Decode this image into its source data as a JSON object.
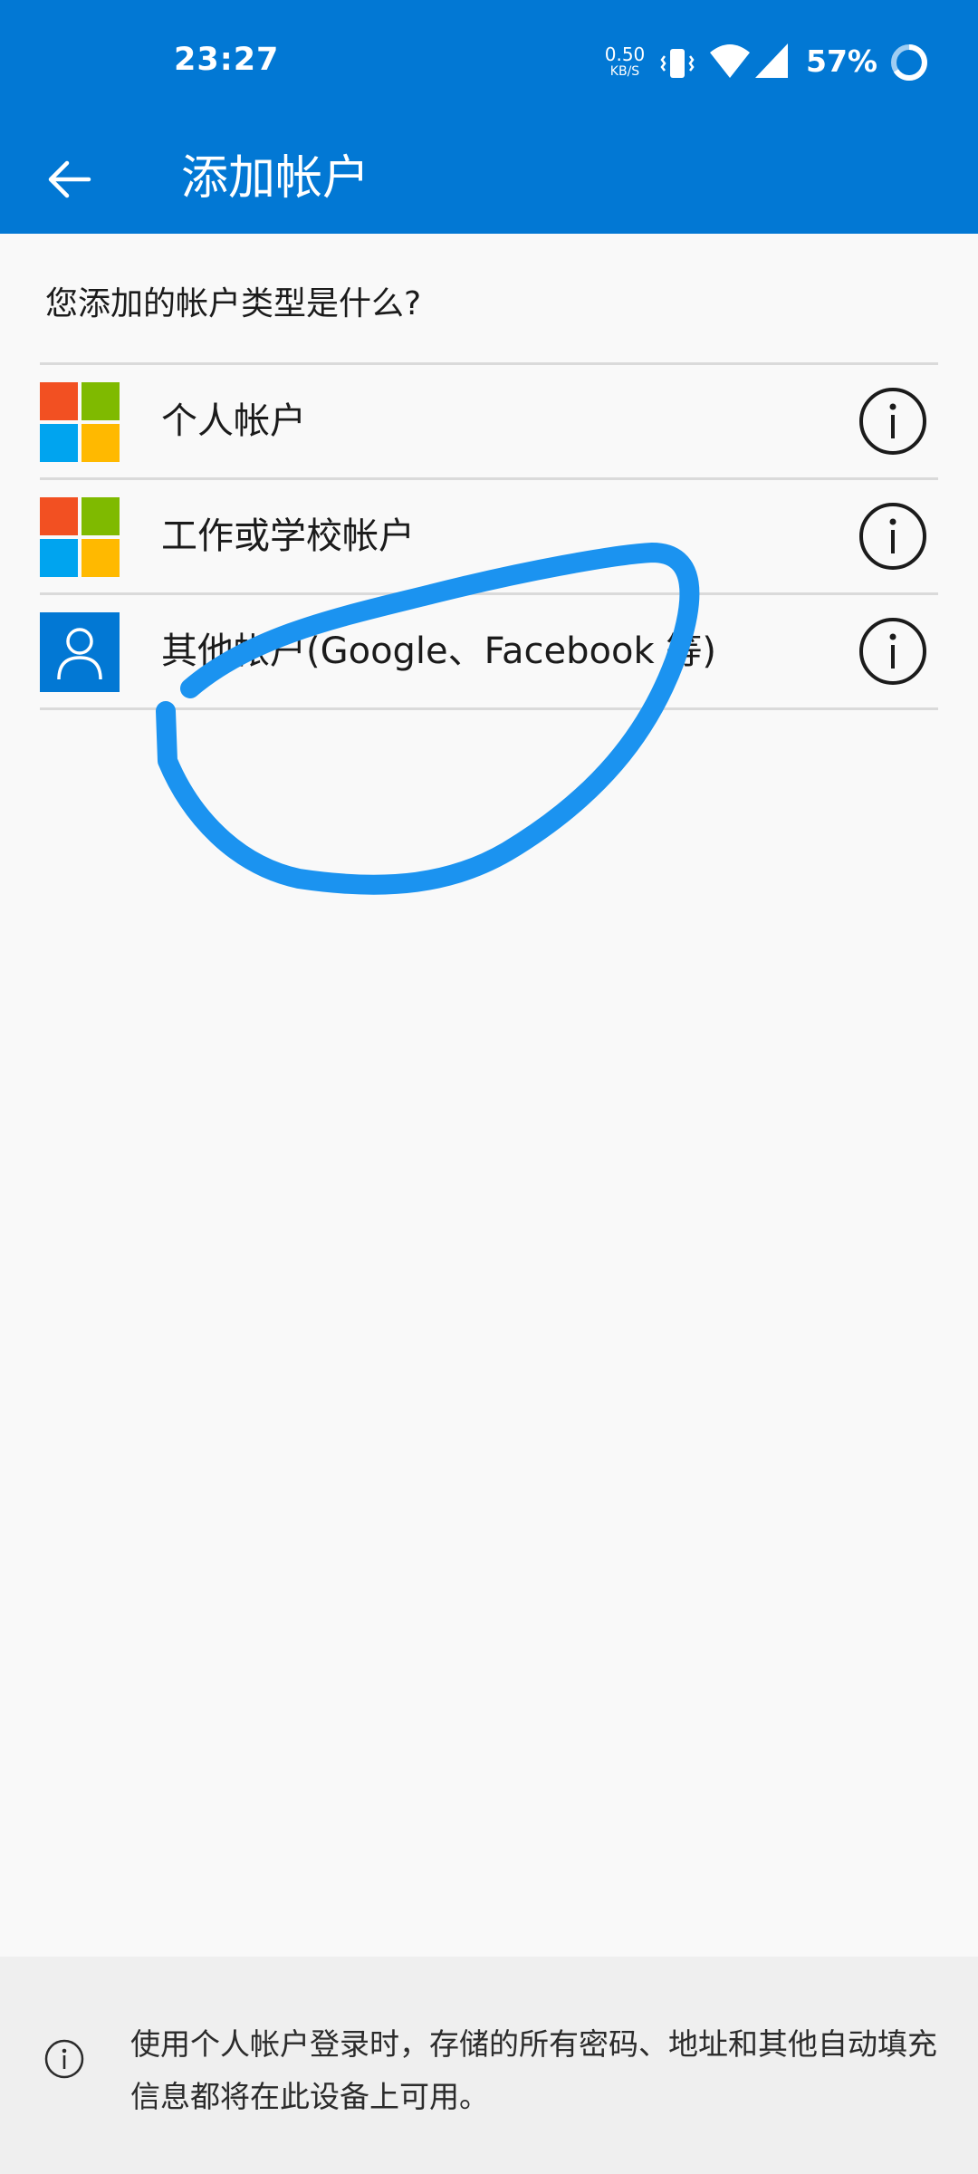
{
  "status_bar": {
    "time": "23:27",
    "net_speed_value": "0.50",
    "net_speed_unit": "KB/S",
    "battery_percent": "57%"
  },
  "app_bar": {
    "title": "添加帐户"
  },
  "question": "您添加的帐户类型是什么?",
  "accounts": [
    {
      "label": "个人帐户",
      "logo": "microsoft-logo"
    },
    {
      "label": "工作或学校帐户",
      "logo": "microsoft-logo"
    },
    {
      "label": "其他帐户(Google、Facebook 等)",
      "logo": "person-icon"
    }
  ],
  "footer": {
    "text": "使用个人帐户登录时，存储的所有密码、地址和其他自动填充信息都将在此设备上可用。"
  },
  "colors": {
    "brand_blue": "#0278d4",
    "scribble_blue": "#1b93f0",
    "ms_red": "#f25022",
    "ms_green": "#7fba00",
    "ms_blue": "#00a4ef",
    "ms_yellow": "#ffb900"
  }
}
